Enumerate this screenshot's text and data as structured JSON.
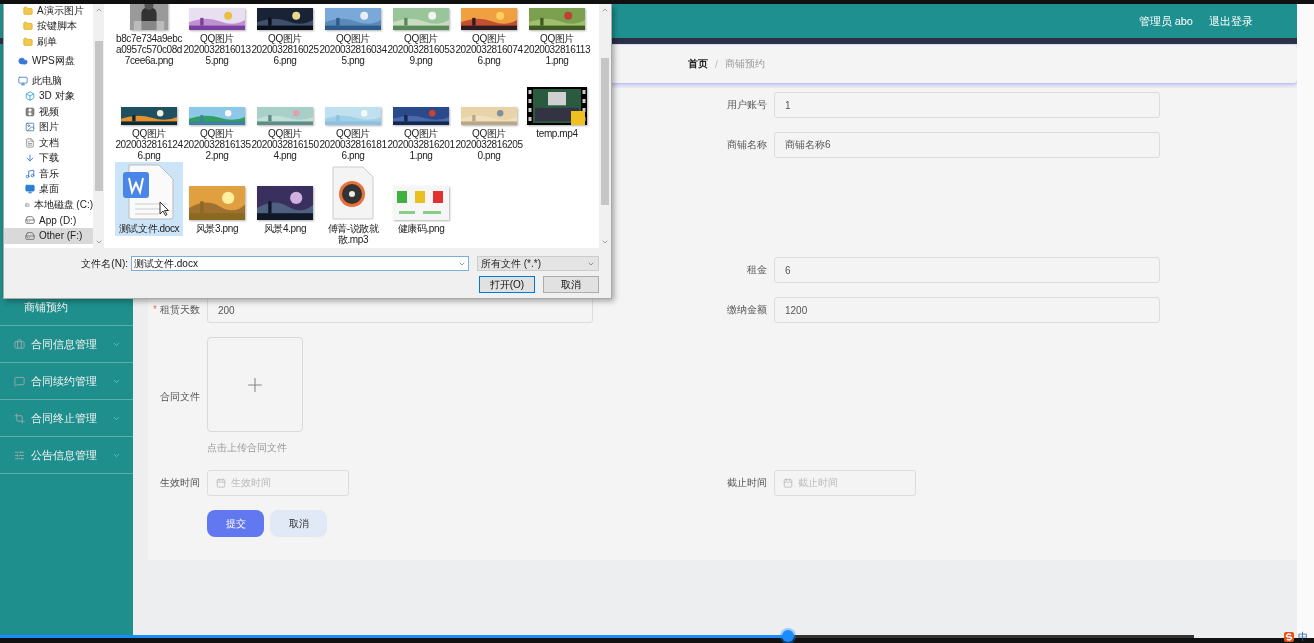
{
  "header": {
    "user": "管理员 abo",
    "logout": "退出登录"
  },
  "breadcrumb": {
    "separator": "/",
    "items": [
      {
        "label": "首页",
        "current": false
      },
      {
        "label": "商铺预约",
        "current": true
      }
    ]
  },
  "sidebar": {
    "items": [
      {
        "label": "商铺预约",
        "kind": "subitem"
      },
      {
        "label": "合同信息管理",
        "kind": "menu"
      },
      {
        "label": "合同续约管理",
        "kind": "menu"
      },
      {
        "label": "合同终止管理",
        "kind": "menu"
      },
      {
        "label": "公告信息管理",
        "kind": "menu"
      }
    ]
  },
  "form": {
    "rows": [
      {
        "right": {
          "kind": "text",
          "label": "用户账号",
          "value": "1"
        }
      },
      {
        "right": {
          "kind": "text",
          "label": "商铺名称",
          "value": "商铺名称6"
        }
      },
      {
        "right": {
          "kind": "text",
          "label": "租金",
          "value": "6"
        }
      },
      {
        "left": {
          "kind": "text",
          "mark": "*",
          "label": "租赁天数",
          "value": "200"
        },
        "right": {
          "kind": "text",
          "label": "缴纳金额",
          "value": "1200"
        }
      },
      {
        "left": {
          "kind": "upload",
          "label": "合同文件",
          "hint": "点击上传合同文件"
        }
      },
      {
        "left": {
          "kind": "date",
          "label": "生效时间",
          "placeholder": "生效时间"
        },
        "right": {
          "kind": "date",
          "label": "截止时间",
          "placeholder": "截止时间"
        }
      }
    ],
    "buttons": [
      {
        "label": "提交",
        "kind": "primary"
      },
      {
        "label": "取消",
        "kind": "default"
      }
    ]
  },
  "file_dialog": {
    "quick_access": [
      {
        "label": "A演示图片",
        "selected": false
      },
      {
        "label": "按键脚本",
        "selected": false
      },
      {
        "label": "刷单",
        "selected": false
      }
    ],
    "nav": [
      {
        "label": "WPS网盘",
        "kind": "cloud",
        "selected": false
      },
      {
        "label": "此电脑",
        "kind": "computer",
        "selected": false,
        "children": [
          {
            "label": "3D 对象",
            "kind": "cube",
            "selected": false
          },
          {
            "label": "视频",
            "kind": "video",
            "selected": false
          },
          {
            "label": "图片",
            "kind": "pictures",
            "selected": false
          },
          {
            "label": "文档",
            "kind": "documents",
            "selected": false
          },
          {
            "label": "下载",
            "kind": "download",
            "selected": false
          },
          {
            "label": "音乐",
            "kind": "music",
            "selected": false
          },
          {
            "label": "桌面",
            "kind": "desktop",
            "selected": false
          },
          {
            "label": "本地磁盘 (C:)",
            "kind": "drive",
            "selected": false
          },
          {
            "label": "App (D:)",
            "kind": "drive",
            "selected": false
          },
          {
            "label": "Other (F:)",
            "kind": "drive",
            "selected": true
          }
        ]
      }
    ],
    "files": [
      {
        "name": "b8c7e734a9ebca0957c570c08d7cee6a.png",
        "kind": "picture",
        "selected": false
      },
      {
        "name": "QQ图片20200328160135.png",
        "kind": "picture",
        "selected": false
      },
      {
        "name": "QQ图片20200328160256.png",
        "kind": "picture",
        "selected": false
      },
      {
        "name": "QQ图片20200328160345.png",
        "kind": "picture",
        "selected": false
      },
      {
        "name": "QQ图片20200328160539.png",
        "kind": "picture",
        "selected": false
      },
      {
        "name": "QQ图片20200328160746.png",
        "kind": "picture",
        "selected": false
      },
      {
        "name": "QQ图片20200328161131.png",
        "kind": "picture",
        "selected": false
      },
      {
        "name": "QQ图片20200328161246.png",
        "kind": "picture",
        "selected": false
      },
      {
        "name": "QQ图片20200328161352.png",
        "kind": "picture",
        "selected": false
      },
      {
        "name": "QQ图片20200328161504.png",
        "kind": "picture",
        "selected": false
      },
      {
        "name": "QQ图片20200328161816.png",
        "kind": "picture",
        "selected": false
      },
      {
        "name": "QQ图片20200328162011.png",
        "kind": "picture",
        "selected": false
      },
      {
        "name": "QQ图片20200328162050.png",
        "kind": "picture",
        "selected": false
      },
      {
        "name": "temp.mp4",
        "kind": "video",
        "selected": false
      },
      {
        "name": "测试文件.docx",
        "kind": "document",
        "selected": true
      },
      {
        "name": "风景3.png",
        "kind": "picture",
        "selected": false
      },
      {
        "name": "风景4.png",
        "kind": "picture",
        "selected": false
      },
      {
        "name": "傅菁-说散就散.mp3",
        "kind": "audio",
        "selected": false
      },
      {
        "name": "健康码.png",
        "kind": "picture",
        "selected": false
      }
    ],
    "filename_label": "文件名(N):",
    "filename": "测试文件.docx",
    "filetype": "所有文件 (*.*)",
    "buttons": [
      {
        "label": "打开(O)",
        "kind": "default"
      },
      {
        "label": "取消",
        "kind": "normal"
      }
    ]
  },
  "player": {
    "level": 0.66
  },
  "tray": {
    "ime": "中"
  }
}
